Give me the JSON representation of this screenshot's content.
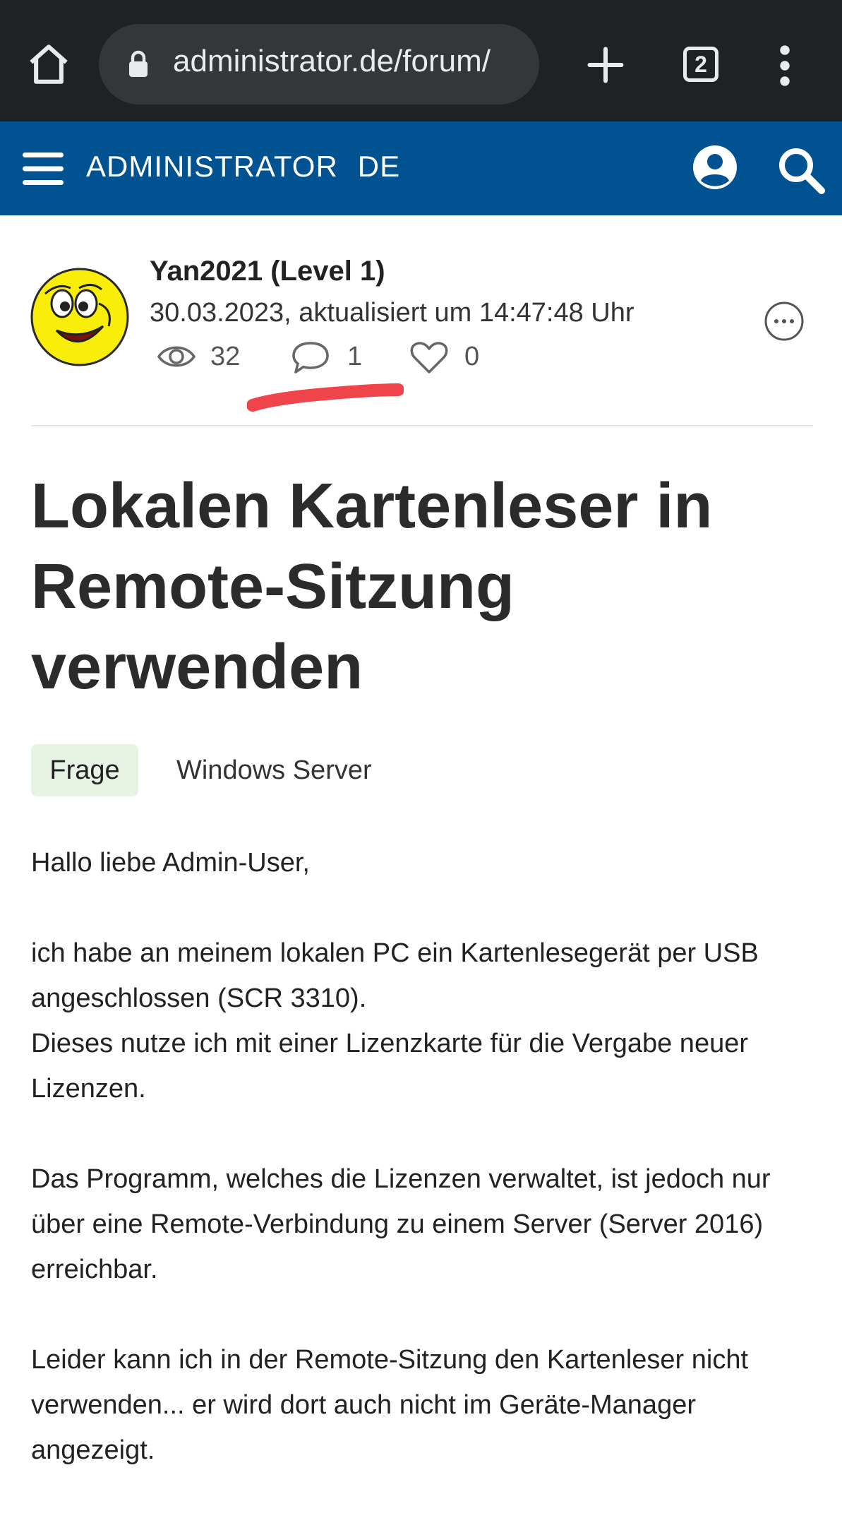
{
  "browser": {
    "url": "administrator.de/forum/",
    "tab_count": "2",
    "icons": [
      "home-icon",
      "lock-icon",
      "plus-icon",
      "tabs-icon",
      "more-vertical-icon"
    ]
  },
  "site": {
    "brand_main": "ADMINISTRATOR",
    "brand_suffix": "DE",
    "header_color": "#005291",
    "icons": [
      "hamburger-icon",
      "user-icon",
      "search-icon"
    ]
  },
  "post": {
    "author": "Yan2021 (Level 1)",
    "date": "30.03.2023, aktualisiert um 14:47:48 Uhr",
    "views": "32",
    "comments": "1",
    "likes": "0",
    "title": "Lokalen Kartenleser in Remote-Sitzung verwenden",
    "tag": "Frage",
    "category": "Windows Server",
    "body": [
      "Hallo liebe Admin-User,",
      "ich habe an meinem lokalen PC ein Kartenlesegerät per USB angeschlossen (SCR 3310).\nDieses nutze ich mit einer Lizenzkarte für die Vergabe neuer Lizenzen.",
      "Das Programm, welches die Lizenzen verwaltet, ist jedoch nur über eine Remote-Verbindung zu einem Server (Server 2016) erreichbar.",
      "Leider kann ich in der Remote-Sitzung den Kartenleser nicht verwenden... er wird dort auch nicht im Geräte-Manager angezeigt."
    ]
  },
  "colors": {
    "tag_bg": "#e7f4e3",
    "annotation_red": "#f0444b"
  }
}
